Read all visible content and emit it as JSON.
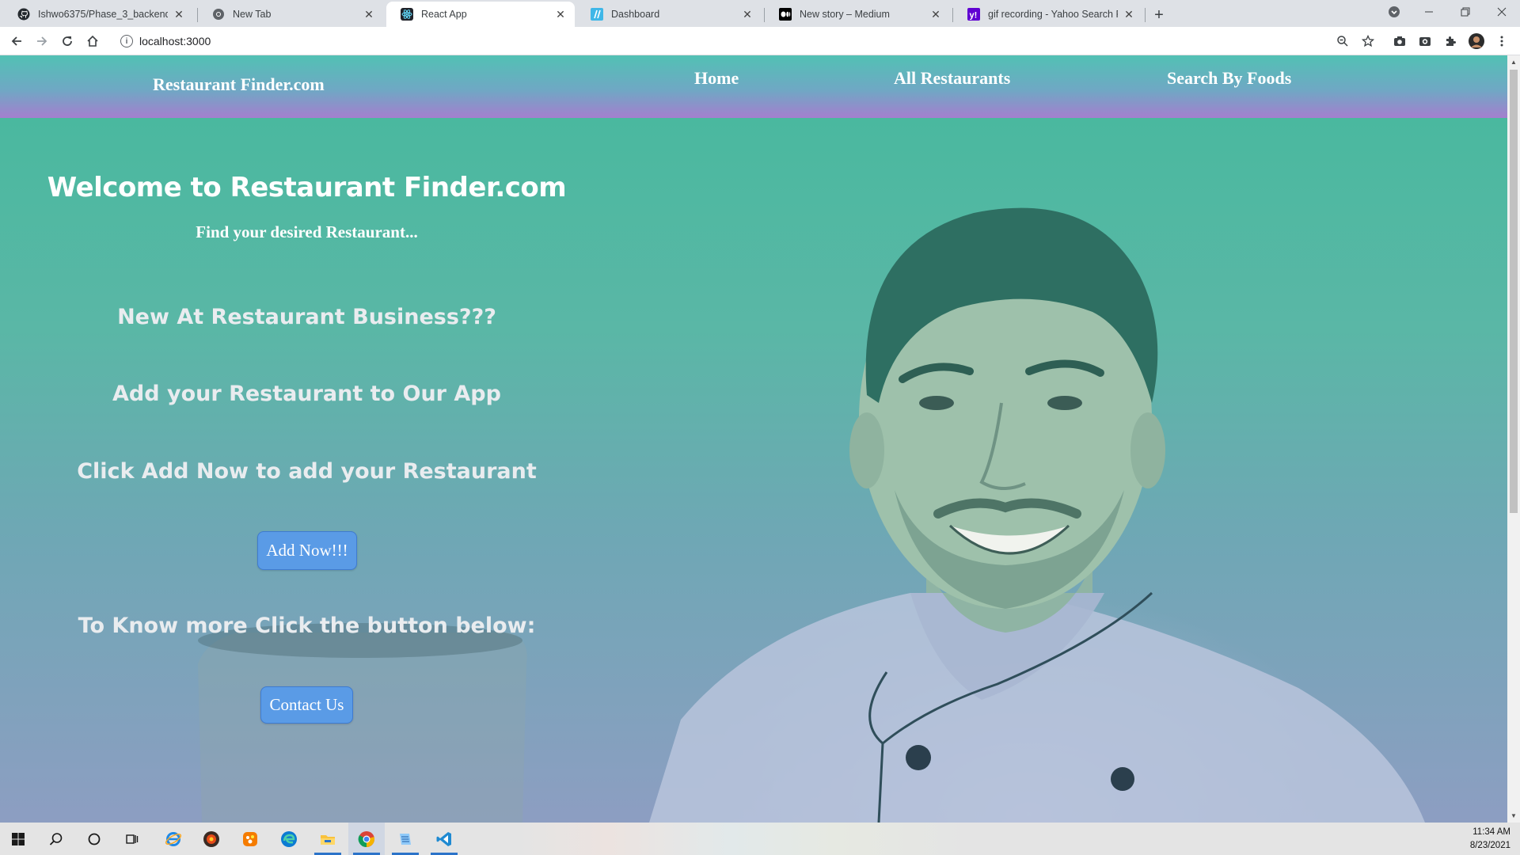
{
  "browser": {
    "tabs": [
      {
        "title": "Ishwo6375/Phase_3_backend_ho",
        "icon": "github-icon",
        "active": false
      },
      {
        "title": "New Tab",
        "icon": "chrome-icon",
        "active": false
      },
      {
        "title": "React App",
        "icon": "react-icon",
        "active": true
      },
      {
        "title": "Dashboard",
        "icon": "dashboard-icon",
        "active": false
      },
      {
        "title": "New story – Medium",
        "icon": "medium-icon",
        "active": false
      },
      {
        "title": "gif recording - Yahoo Search Res",
        "icon": "yahoo-icon",
        "active": false
      }
    ],
    "url": "localhost:3000"
  },
  "navbar": {
    "brand": "Restaurant Finder.com",
    "links": [
      "Home",
      "All Restaurants",
      "Search By Foods"
    ]
  },
  "hero": {
    "title": "Welcome to Restaurant Finder.com",
    "subtitle": "Find your desired Restaurant...",
    "line1": "New At Restaurant Business???",
    "line2": "Add your Restaurant to Our App",
    "line3": "Click Add Now to add your Restaurant",
    "add_button": "Add Now!!!",
    "line4": "To Know more Click the button below:",
    "contact_button": "Contact Us"
  },
  "taskbar": {
    "time": "11:34 AM",
    "date": "8/23/2021"
  },
  "colors": {
    "accent_button": "#5a9be6",
    "navbar_top": "#52c1b4",
    "navbar_bottom": "#a47fce"
  }
}
